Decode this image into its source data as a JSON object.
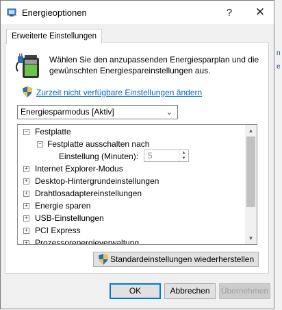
{
  "window": {
    "title": "Energieoptionen",
    "help_glyph": "?",
    "close_glyph": "✕"
  },
  "background": {
    "fragments": [
      "n",
      "e"
    ]
  },
  "tabs": [
    {
      "label": "Erweiterte Einstellungen",
      "active": true
    }
  ],
  "intro": {
    "text": "Wählen Sie den anzupassenden Energiesparplan und die gewünschten Energiespareinstellungen aus."
  },
  "link": {
    "label": "Zurzeit nicht verfügbare Einstellungen ändern"
  },
  "plan_select": {
    "value": "Energiesparmodus [Aktiv]"
  },
  "tree": {
    "items": [
      {
        "label": "Festplatte",
        "expander": "−"
      },
      {
        "label": "Festplatte ausschalten nach",
        "expander": "−"
      },
      {
        "label": "Einstellung (Minuten):",
        "value": "5"
      },
      {
        "label": "Internet Explorer-Modus",
        "expander": "+"
      },
      {
        "label": "Desktop-Hintergrundeinstellungen",
        "expander": "+"
      },
      {
        "label": "Drahtlosadaptereinstellungen",
        "expander": "+"
      },
      {
        "label": "Energie sparen",
        "expander": "+"
      },
      {
        "label": "USB-Einstellungen",
        "expander": "+"
      },
      {
        "label": "PCI Express",
        "expander": "+"
      },
      {
        "label": "Prozessorenergieverwaltung",
        "expander": "+"
      }
    ]
  },
  "restore_button": {
    "label": "Standardeinstellungen wiederherstellen"
  },
  "buttons": {
    "ok": "OK",
    "cancel": "Abbrechen",
    "apply": "Übernehmen"
  },
  "colors": {
    "link": "#0066cc",
    "dialog_bg": "#f0f0f0",
    "default_button_border": "#0078d7"
  }
}
